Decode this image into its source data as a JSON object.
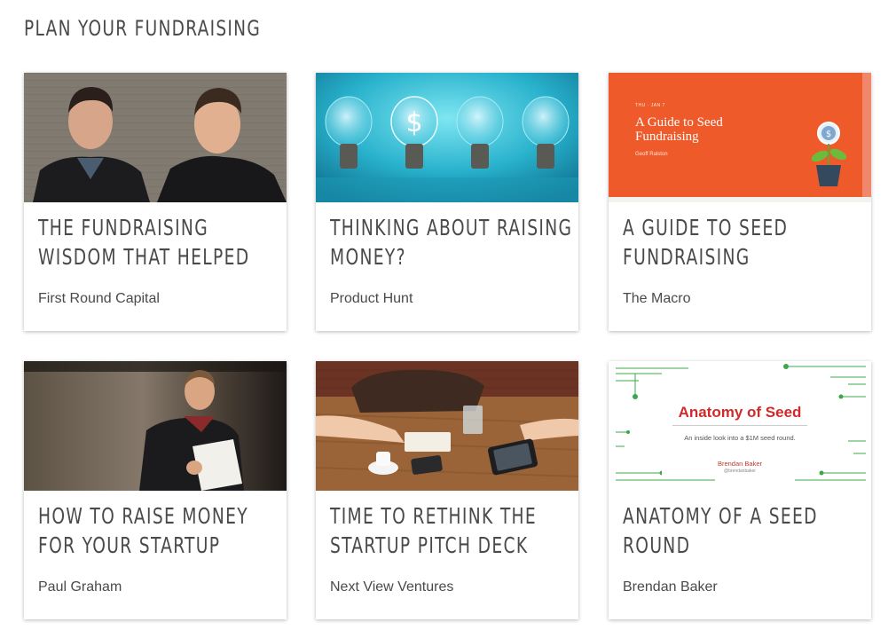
{
  "section": {
    "title": "PLAN YOUR FUNDRAISING"
  },
  "cards": [
    {
      "title": "THE FUNDRAISING WISDOM THAT HELPED",
      "source": "First Round Capital",
      "image": "photo-two-founders"
    },
    {
      "title": "THINKING ABOUT RAISING MONEY?",
      "source": "Product Hunt",
      "image": "photo-light-bulbs-dollar"
    },
    {
      "title": "A GUIDE TO SEED FUNDRAISING",
      "source": "The Macro",
      "image": "slide-guide-to-seed-fundraising",
      "slide": {
        "date": "THU · JAN 7",
        "title": "A Guide to Seed Fundraising",
        "author": "Geoff Ralston"
      }
    },
    {
      "title": "HOW TO RAISE MONEY FOR YOUR STARTUP",
      "source": "Paul Graham",
      "image": "photo-speaker-on-stage"
    },
    {
      "title": "TIME TO RETHINK THE STARTUP PITCH DECK",
      "source": "Next View Ventures",
      "image": "photo-cafe-table-meeting"
    },
    {
      "title": "ANATOMY OF A SEED ROUND",
      "source": "Brendan Baker",
      "image": "slide-anatomy-of-seed",
      "slide": {
        "title": "Anatomy of Seed",
        "subtitle": "An inside look into a $1M seed round.",
        "author": "Brendan Baker",
        "handle": "@brendanbaker"
      }
    }
  ],
  "colors": {
    "text": "#4a4a4a",
    "card_bg": "#ffffff",
    "orange_slide": "#ee5a2a",
    "slide_red": "#d12a2a"
  }
}
